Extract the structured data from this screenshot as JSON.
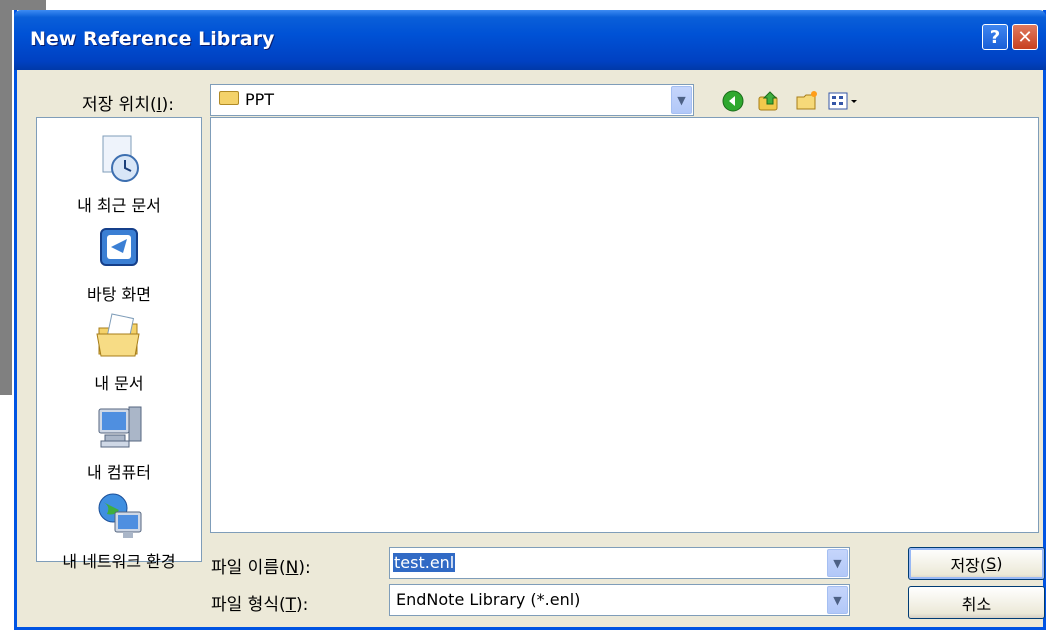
{
  "window": {
    "title": "New Reference Library"
  },
  "colors": {
    "title_bar": "#0054e3",
    "dialog_bg": "#ece9d8",
    "selection": "#316ac5",
    "close_button": "#d7582f"
  },
  "save_in": {
    "label_prefix": "저장 위치(",
    "label_hotkey": "I",
    "label_suffix": "):",
    "value": "PPT"
  },
  "toolbar": [
    "back-icon",
    "up-folder-icon",
    "new-folder-icon",
    "view-menu-icon"
  ],
  "places": [
    {
      "label": "내 최근 문서",
      "icon": "recent-documents-icon"
    },
    {
      "label": "바탕 화면",
      "icon": "desktop-icon"
    },
    {
      "label": "내 문서",
      "icon": "my-documents-icon"
    },
    {
      "label": "내 컴퓨터",
      "icon": "my-computer-icon"
    },
    {
      "label": "내 네트워크 환경",
      "icon": "network-icon"
    }
  ],
  "filename": {
    "label_prefix": "파일 이름(",
    "label_hotkey": "N",
    "label_suffix": "):",
    "value": "test.enl"
  },
  "filetype": {
    "label_prefix": "파일 형식(",
    "label_hotkey": "T",
    "label_suffix": "):",
    "value": "EndNote Library (*.enl)"
  },
  "buttons": {
    "save_prefix": "저장(",
    "save_hotkey": "S",
    "save_suffix": ")",
    "cancel": "취소"
  }
}
